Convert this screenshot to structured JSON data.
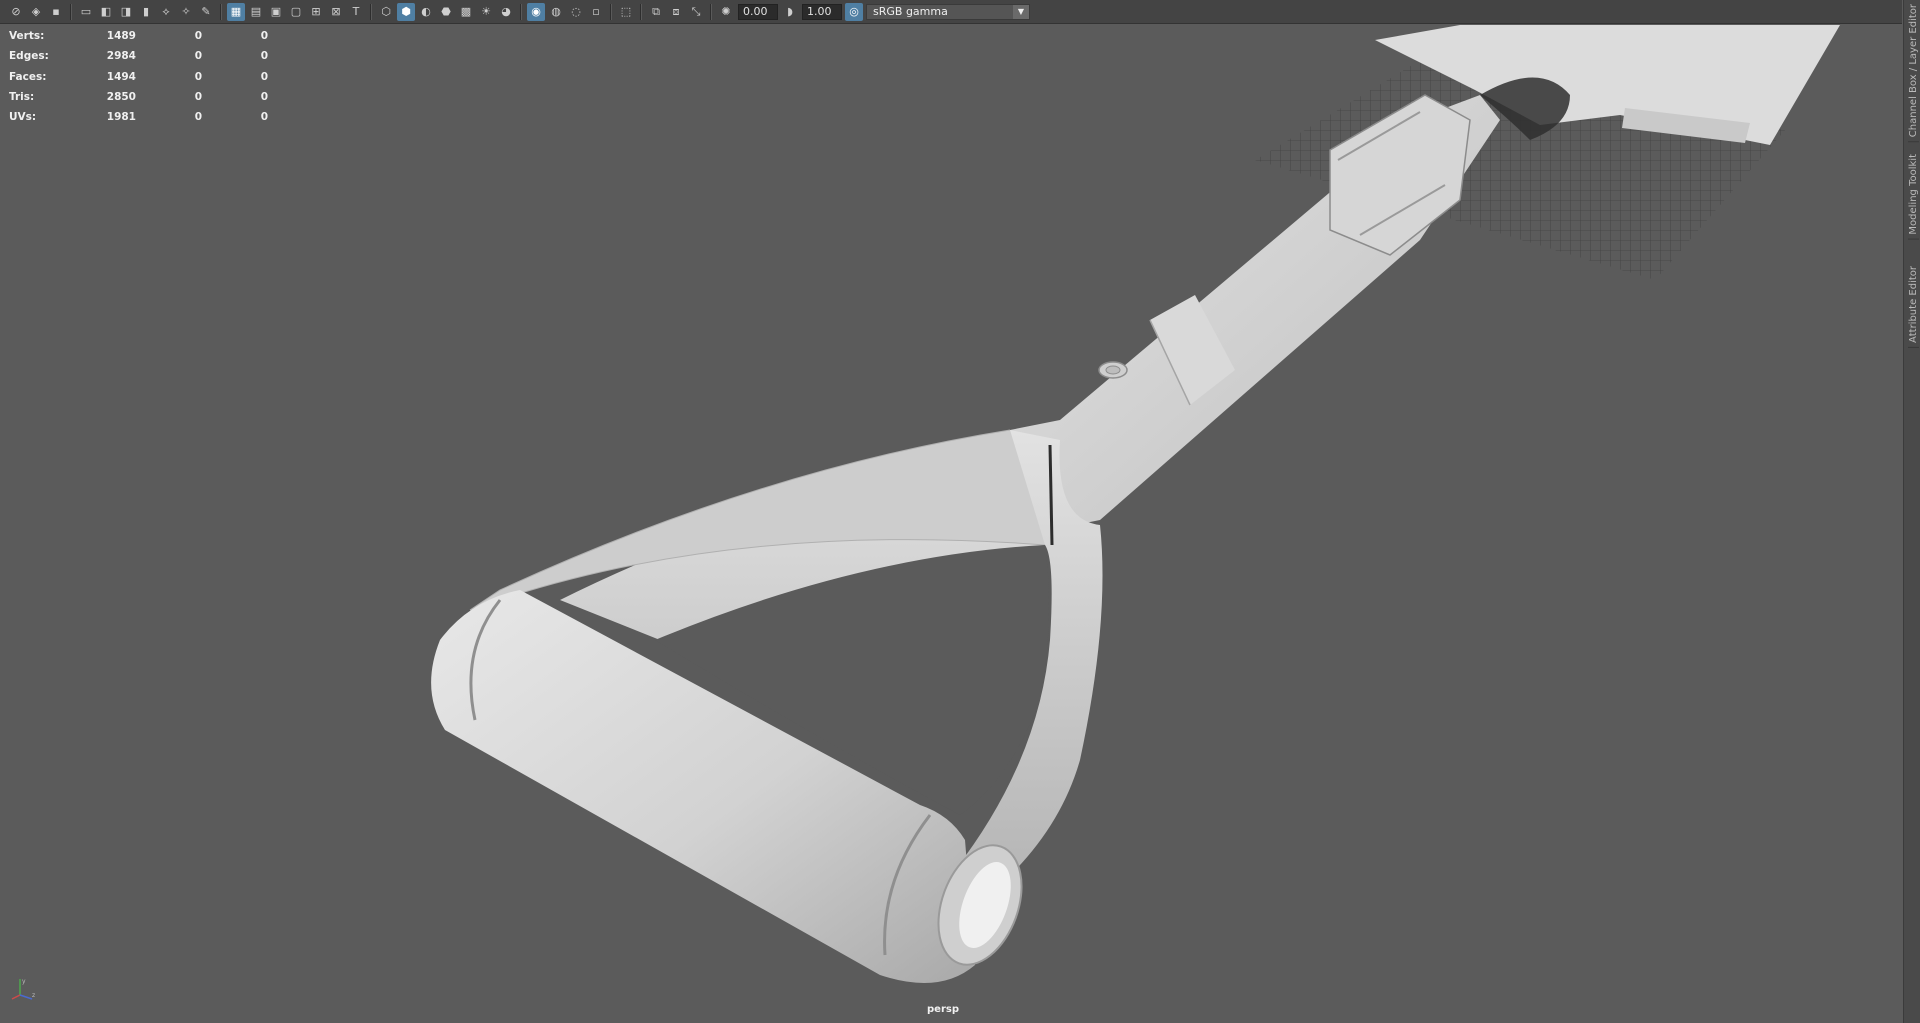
{
  "toolbar": {
    "icons": [
      "select-camera-icon",
      "camera-attributes-icon",
      "bookmark-icon",
      "image-plane-icon",
      "film-gate-icon",
      "resolution-gate-icon",
      "gate-mask-icon",
      "field-chart-icon",
      "safe-action-icon",
      "safe-title-icon",
      "wireframe-icon",
      "smooth-shade-icon",
      "default-material-icon",
      "wireframe-on-shaded-icon",
      "xray-icon",
      "use-all-lights-icon",
      "shadows-icon",
      "screen-space-ao-icon",
      "motion-blur-icon",
      "multisample-aa-icon",
      "depth-of-field-icon",
      "isolate-select-icon",
      "xray-joints-icon",
      "xray-active-icon",
      "camera-exposure-icon",
      "gamma-icon",
      "color-management-icon"
    ],
    "exposure_value": "0.00",
    "gamma_value": "1.00",
    "view_transform": "sRGB gamma"
  },
  "hud": {
    "rows": [
      {
        "label": "Verts:",
        "v1": "1489",
        "v2": "0",
        "v3": "0"
      },
      {
        "label": "Edges:",
        "v1": "2984",
        "v2": "0",
        "v3": "0"
      },
      {
        "label": "Faces:",
        "v1": "1494",
        "v2": "0",
        "v3": "0"
      },
      {
        "label": "Tris:",
        "v1": "2850",
        "v2": "0",
        "v3": "0"
      },
      {
        "label": "UVs:",
        "v1": "1981",
        "v2": "0",
        "v3": "0"
      }
    ]
  },
  "viewport": {
    "camera_label": "persp"
  },
  "side_tabs": {
    "channel_box": "Channel Box / Layer Editor",
    "modeling_toolkit": "Modeling Toolkit",
    "attribute_editor": "Attribute Editor"
  },
  "colors": {
    "viewport_bg": "#5b5b5b",
    "toolbar_bg": "#444444",
    "active_button": "#4f7fa3"
  }
}
